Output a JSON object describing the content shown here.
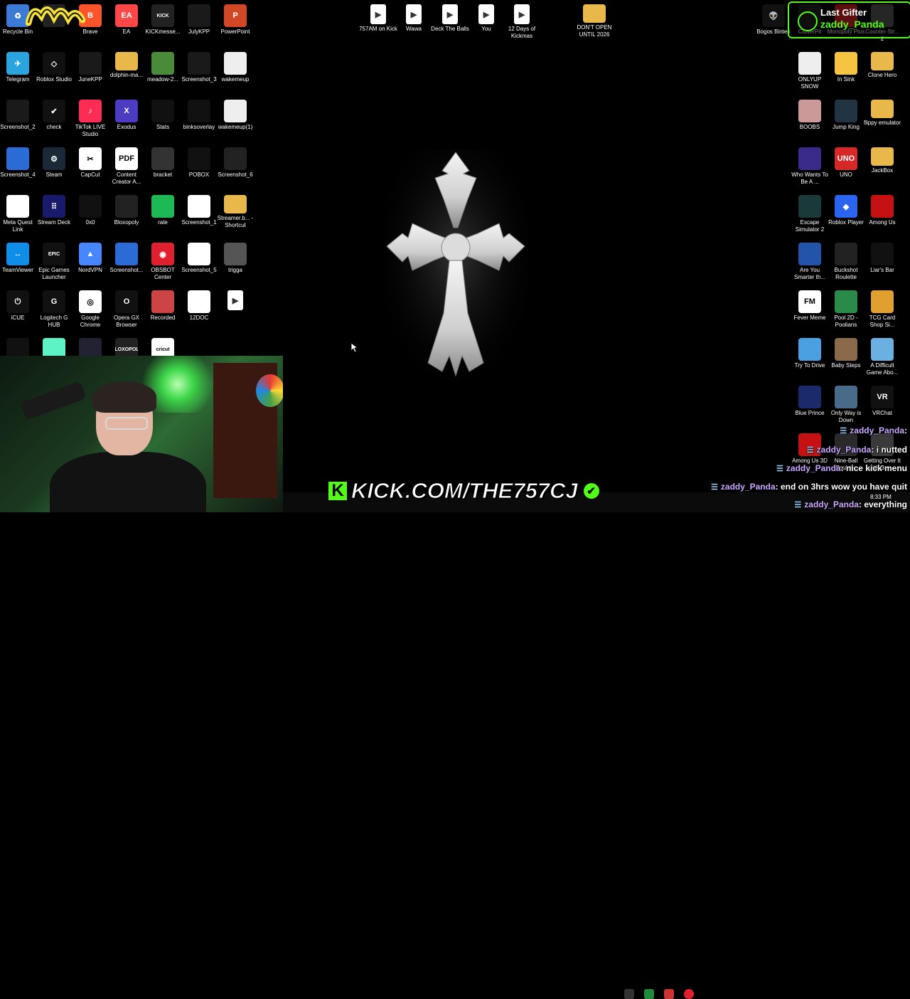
{
  "desktop": {
    "icons_left": [
      {
        "label": "Recycle Bin",
        "icon": "recycle-bin-icon",
        "color": "#3b7bd6",
        "glyph": "♻"
      },
      {
        "label": "",
        "icon": "app-icon",
        "color": "#222",
        "glyph": ""
      },
      {
        "label": "Brave",
        "icon": "brave-icon",
        "color": "#fb542b",
        "glyph": "B"
      },
      {
        "label": "EA",
        "icon": "ea-icon",
        "color": "#ff4747",
        "glyph": "EA"
      },
      {
        "label": "KICKmesse...",
        "icon": "kick-messenger-icon",
        "color": "#222",
        "glyph": "KICK"
      },
      {
        "label": "JulyKPP",
        "icon": "image-icon",
        "color": "#1a1a1a",
        "glyph": ""
      },
      {
        "label": "PowerPoint",
        "icon": "powerpoint-icon",
        "color": "#d24726",
        "glyph": "P"
      },
      {
        "label": "Telegram",
        "icon": "telegram-icon",
        "color": "#2aa3df",
        "glyph": "✈"
      },
      {
        "label": "Roblox Studio",
        "icon": "roblox-studio-icon",
        "color": "#111",
        "glyph": "◇"
      },
      {
        "label": "JuneKPP",
        "icon": "image-icon",
        "color": "#1a1a1a",
        "glyph": ""
      },
      {
        "label": "dolphin-ma...",
        "icon": "folder-icon",
        "color": "#e8b84a",
        "glyph": ""
      },
      {
        "label": "meadow-2...",
        "icon": "image-icon",
        "color": "#4a8b3a",
        "glyph": ""
      },
      {
        "label": "Screenshot_3",
        "icon": "image-icon",
        "color": "#1a1a1a",
        "glyph": ""
      },
      {
        "label": "wakemeup",
        "icon": "qr-icon",
        "color": "#eee",
        "glyph": ""
      },
      {
        "label": "Screenshot_2",
        "icon": "image-icon",
        "color": "#1a1a1a",
        "glyph": ""
      },
      {
        "label": "check",
        "icon": "check-icon",
        "color": "#111",
        "glyph": "✔"
      },
      {
        "label": "TikTok LIVE Studio",
        "icon": "tiktok-icon",
        "color": "#fe2c55",
        "glyph": "♪"
      },
      {
        "label": "Exodus",
        "icon": "exodus-icon",
        "color": "#4b3cc2",
        "glyph": "X"
      },
      {
        "label": "Stats",
        "icon": "image-icon",
        "color": "#111",
        "glyph": ""
      },
      {
        "label": "binksoverlay",
        "icon": "image-icon",
        "color": "#111",
        "glyph": ""
      },
      {
        "label": "wakemeup(1)",
        "icon": "qr-icon",
        "color": "#eee",
        "glyph": ""
      },
      {
        "label": "Screenshot_4",
        "icon": "image-icon",
        "color": "#2b6bd6",
        "glyph": ""
      },
      {
        "label": "Steam",
        "icon": "steam-icon",
        "color": "#1b2838",
        "glyph": "⚙"
      },
      {
        "label": "CapCut",
        "icon": "capcut-icon",
        "color": "#fff",
        "glyph": "✂"
      },
      {
        "label": "Content Creator A...",
        "icon": "pdf-icon",
        "color": "#fff",
        "glyph": "PDF"
      },
      {
        "label": "bracket",
        "icon": "image-icon",
        "color": "#333",
        "glyph": ""
      },
      {
        "label": "POBOX",
        "icon": "image-icon",
        "color": "#111",
        "glyph": ""
      },
      {
        "label": "Screenshot_6",
        "icon": "image-icon",
        "color": "#222",
        "glyph": ""
      },
      {
        "label": "Meta Quest Link",
        "icon": "file-icon",
        "color": "#fff",
        "glyph": ""
      },
      {
        "label": "Stream Deck",
        "icon": "stream-deck-icon",
        "color": "#1a1a6a",
        "glyph": "⠿"
      },
      {
        "label": "0x0",
        "icon": "link-icon",
        "color": "#111",
        "glyph": ""
      },
      {
        "label": "Bloxopoly",
        "icon": "image-icon",
        "color": "#222",
        "glyph": ""
      },
      {
        "label": "rate",
        "icon": "image-icon",
        "color": "#1db954",
        "glyph": ""
      },
      {
        "label": "Screenshot_1",
        "icon": "image-icon",
        "color": "#fff",
        "glyph": ""
      },
      {
        "label": "Streamer.b... - Shortcut",
        "icon": "folder-icon",
        "color": "#e8b84a",
        "glyph": ""
      },
      {
        "label": "TeamViewer",
        "icon": "teamviewer-icon",
        "color": "#0e8ee9",
        "glyph": "↔"
      },
      {
        "label": "Epic Games Launcher",
        "icon": "epic-games-icon",
        "color": "#111",
        "glyph": "EPIC"
      },
      {
        "label": "NordVPN",
        "icon": "nordvpn-icon",
        "color": "#4687ff",
        "glyph": "▲"
      },
      {
        "label": "Screenshot...",
        "icon": "image-icon",
        "color": "#2b6bd6",
        "glyph": ""
      },
      {
        "label": "OBSBOT Center",
        "icon": "obsbot-icon",
        "color": "#e0202e",
        "glyph": "◉"
      },
      {
        "label": "Screenshot_5",
        "icon": "image-icon",
        "color": "#fff",
        "glyph": ""
      },
      {
        "label": "trigga",
        "icon": "image-icon",
        "color": "#555",
        "glyph": ""
      },
      {
        "label": "iCUE",
        "icon": "icue-icon",
        "color": "#111",
        "glyph": "⏻"
      },
      {
        "label": "Logitech G HUB",
        "icon": "logitech-icon",
        "color": "#111",
        "glyph": "G"
      },
      {
        "label": "Google Chrome",
        "icon": "chrome-icon",
        "color": "#fff",
        "glyph": "◎"
      },
      {
        "label": "Opera GX Browser",
        "icon": "opera-gx-icon",
        "color": "#111",
        "glyph": "O"
      },
      {
        "label": "Recorded",
        "icon": "image-icon",
        "color": "#c44",
        "glyph": ""
      },
      {
        "label": "12DOC",
        "icon": "image-icon",
        "color": "#fff",
        "glyph": ""
      },
      {
        "label": "",
        "icon": "video-icon",
        "color": "#fff",
        "glyph": "▶"
      },
      {
        "label": "",
        "icon": "app-icon",
        "color": "#111",
        "glyph": ""
      },
      {
        "label": "",
        "icon": "app-icon",
        "color": "#5ef3c4",
        "glyph": ""
      },
      {
        "label": "",
        "icon": "image-icon",
        "color": "#223",
        "glyph": ""
      },
      {
        "label": "",
        "icon": "image-icon",
        "color": "#222",
        "glyph": "BLOXOPOLY"
      },
      {
        "label": "",
        "icon": "cricut-icon",
        "color": "#fff",
        "glyph": "cricut"
      }
    ],
    "icons_top_center": [
      {
        "label": "757AM on Kick",
        "icon": "video-icon"
      },
      {
        "label": "Wawa",
        "icon": "video-icon"
      },
      {
        "label": "Deck The Balls",
        "icon": "video-icon"
      },
      {
        "label": "You",
        "icon": "video-icon"
      },
      {
        "label": "12 Days of Kickmas",
        "icon": "video-icon"
      },
      {
        "label": "DON'T OPEN UNTIL 2026",
        "icon": "folder-icon"
      }
    ],
    "icons_right": [
      {
        "label": "Bogos Binted",
        "icon": "alien-icon",
        "color": "#111",
        "glyph": "👽"
      },
      {
        "label": "CloverPit",
        "icon": "game-icon",
        "color": "#222",
        "glyph": ""
      },
      {
        "label": "Monopoly Plus",
        "icon": "game-icon",
        "color": "#c22",
        "glyph": ""
      },
      {
        "label": "Counter-Str... 2",
        "icon": "game-icon",
        "color": "#555",
        "glyph": ""
      },
      {
        "label": "ONLYUP SNOW",
        "icon": "game-icon",
        "color": "#eee",
        "glyph": ""
      },
      {
        "label": "In Sink",
        "icon": "game-icon",
        "color": "#f5c542",
        "glyph": ""
      },
      {
        "label": "Clone Hero",
        "icon": "folder-icon",
        "color": "#e8b84a",
        "glyph": ""
      },
      {
        "label": "BOOBS",
        "icon": "image-icon",
        "color": "#c99",
        "glyph": ""
      },
      {
        "label": "Jump King",
        "icon": "game-icon",
        "color": "#234",
        "glyph": ""
      },
      {
        "label": "flippy emulator",
        "icon": "folder-icon",
        "color": "#e8b84a",
        "glyph": ""
      },
      {
        "label": "Who Wants To Be A ...",
        "icon": "game-icon",
        "color": "#3a2a8a",
        "glyph": ""
      },
      {
        "label": "UNO",
        "icon": "uno-icon",
        "color": "#d62828",
        "glyph": "UNO"
      },
      {
        "label": "JackBox",
        "icon": "folder-icon",
        "color": "#e8b84a",
        "glyph": ""
      },
      {
        "label": "Escape Simulator 2",
        "icon": "game-icon",
        "color": "#1a3a3a",
        "glyph": ""
      },
      {
        "label": "Roblox Player",
        "icon": "roblox-icon",
        "color": "#2a64ef",
        "glyph": "◆"
      },
      {
        "label": "Among Us",
        "icon": "among-us-icon",
        "color": "#c51111",
        "glyph": ""
      },
      {
        "label": "Are You Smarter th...",
        "icon": "game-icon",
        "color": "#2255aa",
        "glyph": ""
      },
      {
        "label": "Buckshot Roulette",
        "icon": "game-icon",
        "color": "#222",
        "glyph": ""
      },
      {
        "label": "Liar's Bar",
        "icon": "game-icon",
        "color": "#111",
        "glyph": ""
      },
      {
        "label": "Fever Meme",
        "icon": "game-icon",
        "color": "#fff",
        "glyph": "FM"
      },
      {
        "label": "Pool 2D - Poolians",
        "icon": "game-icon",
        "color": "#2a8a4a",
        "glyph": ""
      },
      {
        "label": "TCG Card Shop Si...",
        "icon": "game-icon",
        "color": "#e0a030",
        "glyph": ""
      },
      {
        "label": "Try To Drive",
        "icon": "game-icon",
        "color": "#4aa0e0",
        "glyph": ""
      },
      {
        "label": "Baby Steps",
        "icon": "game-icon",
        "color": "#8a6a4a",
        "glyph": ""
      },
      {
        "label": "A Difficult Game Abo...",
        "icon": "game-icon",
        "color": "#6ab0e0",
        "glyph": ""
      },
      {
        "label": "Blue Prince",
        "icon": "game-icon",
        "color": "#1a2a6a",
        "glyph": ""
      },
      {
        "label": "Only Way is Down",
        "icon": "game-icon",
        "color": "#4a6a8a",
        "glyph": ""
      },
      {
        "label": "VRChat",
        "icon": "vrchat-icon",
        "color": "#111",
        "glyph": "VR"
      },
      {
        "label": "Among Us 3D",
        "icon": "game-icon",
        "color": "#c51111",
        "glyph": ""
      },
      {
        "label": "Nine-Ball Roulette",
        "icon": "game-icon",
        "color": "#2a2a2a",
        "glyph": ""
      },
      {
        "label": "Getting Over It with Ben...",
        "icon": "game-icon",
        "color": "#3a3a3a",
        "glyph": ""
      }
    ]
  },
  "overlay": {
    "last_gifter_title": "Last Gifter",
    "last_gifter_name": "zaddy_Panda",
    "kick_url": "KICK.COM/THE757CJ",
    "kick_letter": "K",
    "clock": "8:33 PM"
  },
  "chat": [
    {
      "user": "zaddy_Panda",
      "msg": ""
    },
    {
      "user": "zaddy_Panda",
      "msg": "i nutted"
    },
    {
      "user": "zaddy_Panda",
      "msg": "nice kick menu"
    },
    {
      "user": "zaddy_Panda",
      "msg": "end on 3hrs wow you have quit"
    },
    {
      "user": "zaddy_Panda",
      "msg": "everything"
    }
  ],
  "colors": {
    "kick_green": "#53fc18",
    "chat_user": "#c9a7ff"
  }
}
